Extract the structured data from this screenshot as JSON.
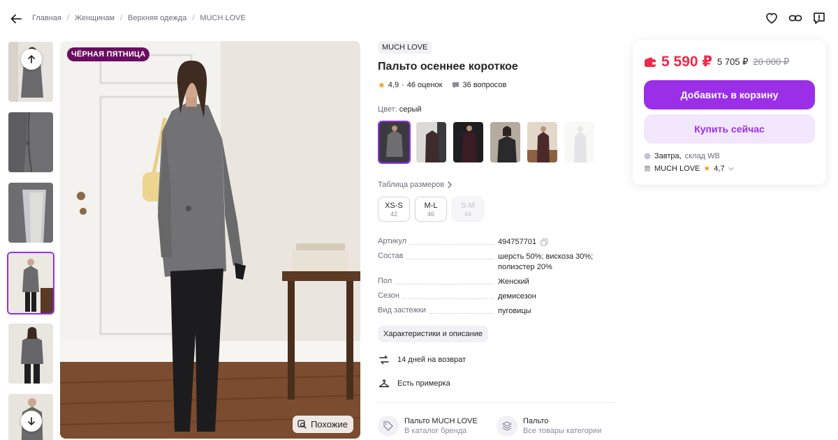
{
  "breadcrumb": [
    "Главная",
    "Женщинам",
    "Верхняя одежда",
    "MUCH LOVE"
  ],
  "gallery": {
    "promo_badge": "ЧЁРНАЯ ПЯТНИЦА",
    "similar_label": "Похожие",
    "thumbnail_count": 6,
    "active_thumbnail": 4
  },
  "product": {
    "brand": "MUCH LOVE",
    "title": "Пальто осеннее короткое",
    "rating": "4,9",
    "ratings_count": "46 оценок",
    "questions": "36 вопросов",
    "color_label": "Цвет:",
    "color_value": "серый",
    "size_table_label": "Таблица размеров",
    "sizes": [
      {
        "label": "XS-S",
        "num": "42",
        "available": true
      },
      {
        "label": "M-L",
        "num": "46",
        "available": true
      },
      {
        "label": "S-M",
        "num": "44",
        "available": false
      }
    ],
    "specs": [
      {
        "key": "Артикул",
        "value": "494757701"
      },
      {
        "key": "Состав",
        "value": "шерсть 50%; вискоза 30%; полиэстер 20%"
      },
      {
        "key": "Пол",
        "value": "Женский"
      },
      {
        "key": "Сезон",
        "value": "демисезон"
      },
      {
        "key": "Вид застежки",
        "value": "пуговицы"
      }
    ],
    "chars_button": "Характеристики и описание",
    "perks": [
      "14 дней на возврат",
      "Есть примерка"
    ],
    "links": [
      {
        "title": "Пальто MUCH LOVE",
        "subtitle": "В каталог бренда"
      },
      {
        "title": "Пальто",
        "subtitle": "Все товары категории"
      }
    ]
  },
  "buy": {
    "price": "5 590 ₽",
    "price_alt": "5 705 ₽",
    "price_old": "20 000 ₽",
    "add_to_cart": "Добавить в корзину",
    "buy_now": "Купить сейчас",
    "delivery_day": "Завтра,",
    "delivery_warehouse": "склад WB",
    "seller_name": "MUCH LOVE",
    "seller_rating": "4,7"
  },
  "colors": {
    "accent": "#9b2fe8",
    "price": "#f0284a",
    "badge": "#6b0d5f"
  }
}
